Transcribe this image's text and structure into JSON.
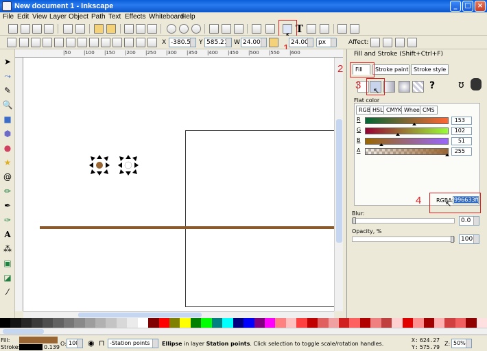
{
  "window": {
    "title": "New document 1 - Inkscape",
    "min": "_",
    "max": "□",
    "close": "×"
  },
  "menu": [
    "File",
    "Edit",
    "View",
    "Layer",
    "Object",
    "Path",
    "Text",
    "Effects",
    "Whiteboard",
    "Help"
  ],
  "controls": {
    "x_label": "X",
    "x_value": "-380.50",
    "y_label": "Y",
    "y_value": "585.21",
    "w_label": "W",
    "w_value": "24.000",
    "h_value": "24.000",
    "unit": "px",
    "affect_label": "Affect:"
  },
  "annotations": [
    "1",
    "2",
    "3",
    "4"
  ],
  "ruler_top": [
    "|50",
    "|100",
    "|150",
    "|200",
    "|250",
    "|300",
    "|350",
    "|400",
    "|450",
    "|500",
    "|550",
    "|600"
  ],
  "panel": {
    "title": "Fill and Stroke (Shift+Ctrl+F)",
    "tabs": {
      "fill": "Fill",
      "stroke_paint": "Stroke paint",
      "stroke_style": "Stroke style"
    },
    "unknown_paint": "?",
    "flat_color_label": "Flat color",
    "subtabs": [
      "RGB",
      "HSL",
      "CMYK",
      "Wheel",
      "CMS"
    ],
    "channels": [
      {
        "label": "R",
        "value": "153",
        "fraction": 0.6
      },
      {
        "label": "G",
        "value": "102",
        "fraction": 0.4
      },
      {
        "label": "B",
        "value": "51",
        "fraction": 0.2
      },
      {
        "label": "A",
        "value": "255",
        "fraction": 1.0
      }
    ],
    "rgba_label": "RGBA:",
    "rgba_value": "996633ff",
    "blur_label": "Blur:",
    "blur_value": "0.0",
    "opacity_label": "Opacity, %",
    "opacity_value": "100.0"
  },
  "status": {
    "fill_label": "Fill:",
    "stroke_label": "Stroke:",
    "stroke_width": "0.139",
    "opacity_label": "O:",
    "opacity_value": "100",
    "layer": "-Station points",
    "message_bold": "Ellipse",
    "message_rest": " in layer ",
    "message_layer": "Station points",
    "message_tail": ". Click selection to toggle scale/rotation handles.",
    "x_label": "X:",
    "x_value": "624.27",
    "y_label": "Y:",
    "y_value": "575.79",
    "zoom_label": "Z:",
    "zoom_value": "50%"
  },
  "colors": {
    "fill_swatch": "#996633",
    "line": "#8b5a2b",
    "accent_red": "#e02020"
  }
}
